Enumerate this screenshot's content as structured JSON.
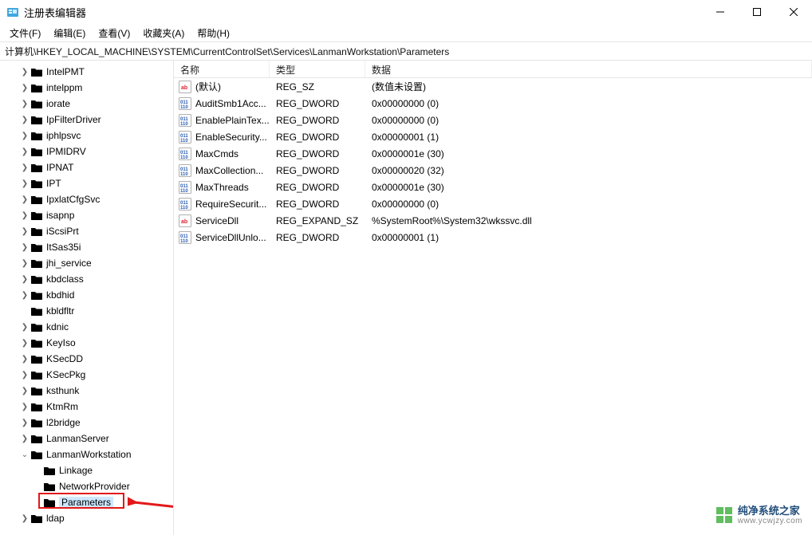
{
  "window": {
    "title": "注册表编辑器"
  },
  "menu": {
    "file": "文件(F)",
    "edit": "编辑(E)",
    "view": "查看(V)",
    "favorites": "收藏夹(A)",
    "help": "帮助(H)"
  },
  "address": "计算机\\HKEY_LOCAL_MACHINE\\SYSTEM\\CurrentControlSet\\Services\\LanmanWorkstation\\Parameters",
  "tree": {
    "items": [
      {
        "label": "IntelPMT",
        "exp": ">"
      },
      {
        "label": "intelppm",
        "exp": ">"
      },
      {
        "label": "iorate",
        "exp": ">"
      },
      {
        "label": "IpFilterDriver",
        "exp": ">"
      },
      {
        "label": "iphlpsvc",
        "exp": ">"
      },
      {
        "label": "IPMIDRV",
        "exp": ">"
      },
      {
        "label": "IPNAT",
        "exp": ">"
      },
      {
        "label": "IPT",
        "exp": ">"
      },
      {
        "label": "IpxlatCfgSvc",
        "exp": ">"
      },
      {
        "label": "isapnp",
        "exp": ">"
      },
      {
        "label": "iScsiPrt",
        "exp": ">"
      },
      {
        "label": "ItSas35i",
        "exp": ">"
      },
      {
        "label": "jhi_service",
        "exp": ">"
      },
      {
        "label": "kbdclass",
        "exp": ">"
      },
      {
        "label": "kbdhid",
        "exp": ">"
      },
      {
        "label": "kbldfltr",
        "exp": ""
      },
      {
        "label": "kdnic",
        "exp": ">"
      },
      {
        "label": "KeyIso",
        "exp": ">"
      },
      {
        "label": "KSecDD",
        "exp": ">"
      },
      {
        "label": "KSecPkg",
        "exp": ">"
      },
      {
        "label": "ksthunk",
        "exp": ">"
      },
      {
        "label": "KtmRm",
        "exp": ">"
      },
      {
        "label": "l2bridge",
        "exp": ">"
      },
      {
        "label": "LanmanServer",
        "exp": ">"
      },
      {
        "label": "LanmanWorkstation",
        "exp": "v"
      }
    ],
    "children": [
      {
        "label": "Linkage"
      },
      {
        "label": "NetworkProvider"
      },
      {
        "label": "Parameters",
        "selected": true
      }
    ],
    "after": [
      {
        "label": "ldap",
        "exp": ">"
      }
    ]
  },
  "columns": {
    "name": "名称",
    "type": "类型",
    "data": "数据"
  },
  "values": [
    {
      "icon": "sz",
      "name": "(默认)",
      "type": "REG_SZ",
      "data": "(数值未设置)"
    },
    {
      "icon": "dw",
      "name": "AuditSmb1Acc...",
      "type": "REG_DWORD",
      "data": "0x00000000 (0)"
    },
    {
      "icon": "dw",
      "name": "EnablePlainTex...",
      "type": "REG_DWORD",
      "data": "0x00000000 (0)"
    },
    {
      "icon": "dw",
      "name": "EnableSecurity...",
      "type": "REG_DWORD",
      "data": "0x00000001 (1)"
    },
    {
      "icon": "dw",
      "name": "MaxCmds",
      "type": "REG_DWORD",
      "data": "0x0000001e (30)"
    },
    {
      "icon": "dw",
      "name": "MaxCollection...",
      "type": "REG_DWORD",
      "data": "0x00000020 (32)"
    },
    {
      "icon": "dw",
      "name": "MaxThreads",
      "type": "REG_DWORD",
      "data": "0x0000001e (30)"
    },
    {
      "icon": "dw",
      "name": "RequireSecurit...",
      "type": "REG_DWORD",
      "data": "0x00000000 (0)"
    },
    {
      "icon": "sz",
      "name": "ServiceDll",
      "type": "REG_EXPAND_SZ",
      "data": "%SystemRoot%\\System32\\wkssvc.dll"
    },
    {
      "icon": "dw",
      "name": "ServiceDllUnlo...",
      "type": "REG_DWORD",
      "data": "0x00000001 (1)"
    }
  ],
  "watermark": {
    "line1": "纯净系统之家",
    "line2": "www.ycwjzy.com"
  }
}
